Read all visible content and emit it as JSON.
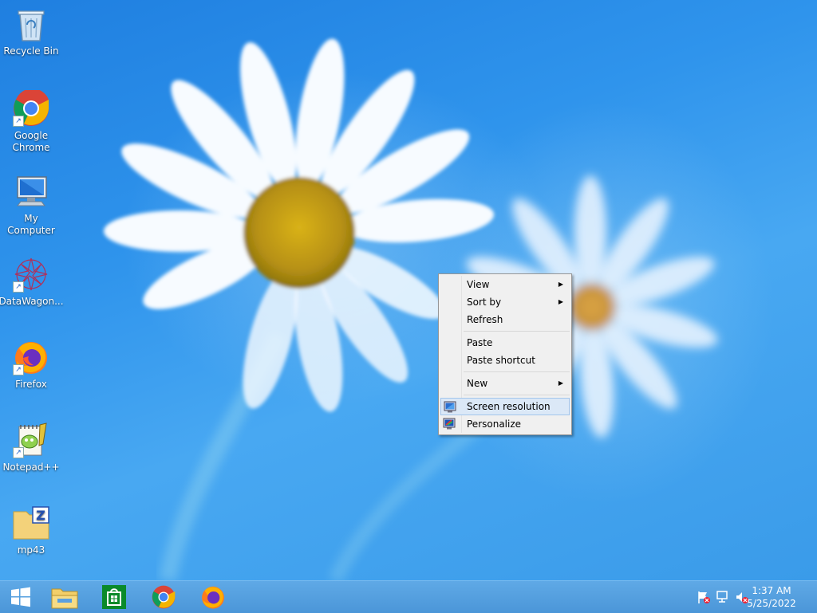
{
  "desktop": {
    "icons": [
      {
        "label": "Recycle Bin",
        "icon": "recycle-bin-icon",
        "shortcut": false
      },
      {
        "label": "Google Chrome",
        "icon": "chrome-icon",
        "shortcut": true
      },
      {
        "label": "My Computer",
        "icon": "computer-icon",
        "shortcut": false
      },
      {
        "label": "DataWagon...",
        "icon": "datawagon-icon",
        "shortcut": true
      },
      {
        "label": "Firefox",
        "icon": "firefox-icon",
        "shortcut": true
      },
      {
        "label": "Notepad++",
        "icon": "notepadpp-icon",
        "shortcut": true
      },
      {
        "label": "mp43",
        "icon": "zip-folder-icon",
        "shortcut": false
      }
    ]
  },
  "context_menu": {
    "items": [
      {
        "label": "View",
        "submenu": true
      },
      {
        "label": "Sort by",
        "submenu": true
      },
      {
        "label": "Refresh",
        "submenu": false
      },
      {
        "label": "Paste",
        "submenu": false
      },
      {
        "label": "Paste shortcut",
        "submenu": false
      },
      {
        "label": "New",
        "submenu": true
      },
      {
        "label": "Screen resolution",
        "submenu": false,
        "highlighted": true,
        "icon": "screen-resolution-icon"
      },
      {
        "label": "Personalize",
        "submenu": false,
        "icon": "personalize-icon"
      }
    ],
    "arrow_glyph": "▶"
  },
  "taskbar": {
    "pinned": [
      "start-button",
      "file-explorer-icon",
      "store-icon",
      "chrome-icon",
      "firefox-icon"
    ],
    "tray": [
      "action-center-flag-icon",
      "network-icon",
      "volume-muted-icon"
    ],
    "clock": {
      "time": "1:37 AM",
      "date": "5/25/2022"
    }
  },
  "colors": {
    "desktop_blue": "#2f94ec",
    "taskbar": "#4b96d8",
    "menu_bg": "#f0f0f0",
    "menu_highlight": "#dbe8f7",
    "menu_highlight_border": "#a3c5ec"
  }
}
